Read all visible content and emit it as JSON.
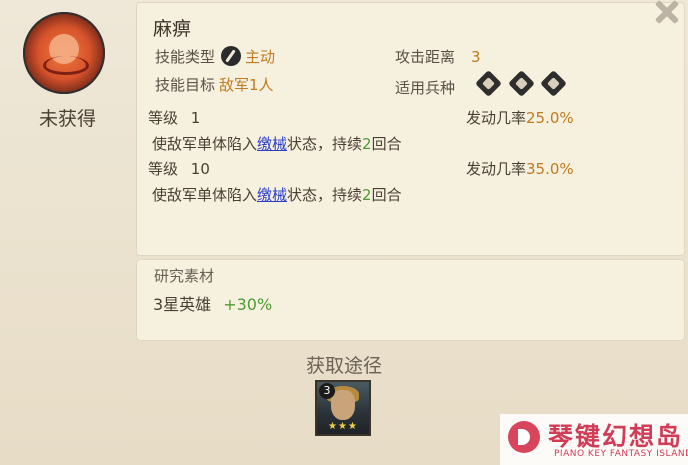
{
  "skill": {
    "status_label": "未获得",
    "name": "麻痹",
    "type_label": "技能类型",
    "type_value": "主动",
    "range_label": "攻击距离",
    "range_value": "3",
    "target_label": "技能目标",
    "target_value": "敌军1人",
    "troops_label": "适用兵种",
    "troop_icons": [
      "spear-troop-icon",
      "shield-troop-icon",
      "bow-troop-icon"
    ]
  },
  "levels": [
    {
      "level_label": "等级",
      "level_value": "1",
      "rate_label": "发动几率",
      "rate_value": "25.0%",
      "desc_pre": "使敌军单体陷入",
      "desc_link": "缴械",
      "desc_mid": "状态，持续",
      "desc_num": "2",
      "desc_post": "回合"
    },
    {
      "level_label": "等级",
      "level_value": "10",
      "rate_label": "发动几率",
      "rate_value": "35.0%",
      "desc_pre": "使敌军单体陷入",
      "desc_link": "缴械",
      "desc_mid": "状态，持续",
      "desc_num": "2",
      "desc_post": "回合"
    }
  ],
  "research": {
    "title": "研究素材",
    "material": "3星英雄",
    "bonus": "+30%"
  },
  "obtain": {
    "title": "获取途径",
    "hero_badge": "3",
    "hero_stars": "★★★"
  },
  "watermark": {
    "title": "琴键幻想岛",
    "subtitle": "PIANO KEY FANTASY ISLAND"
  },
  "colors": {
    "accent_orange": "#c07a1f",
    "accent_green": "#4d9a35",
    "link_blue": "#2a3fc4"
  }
}
